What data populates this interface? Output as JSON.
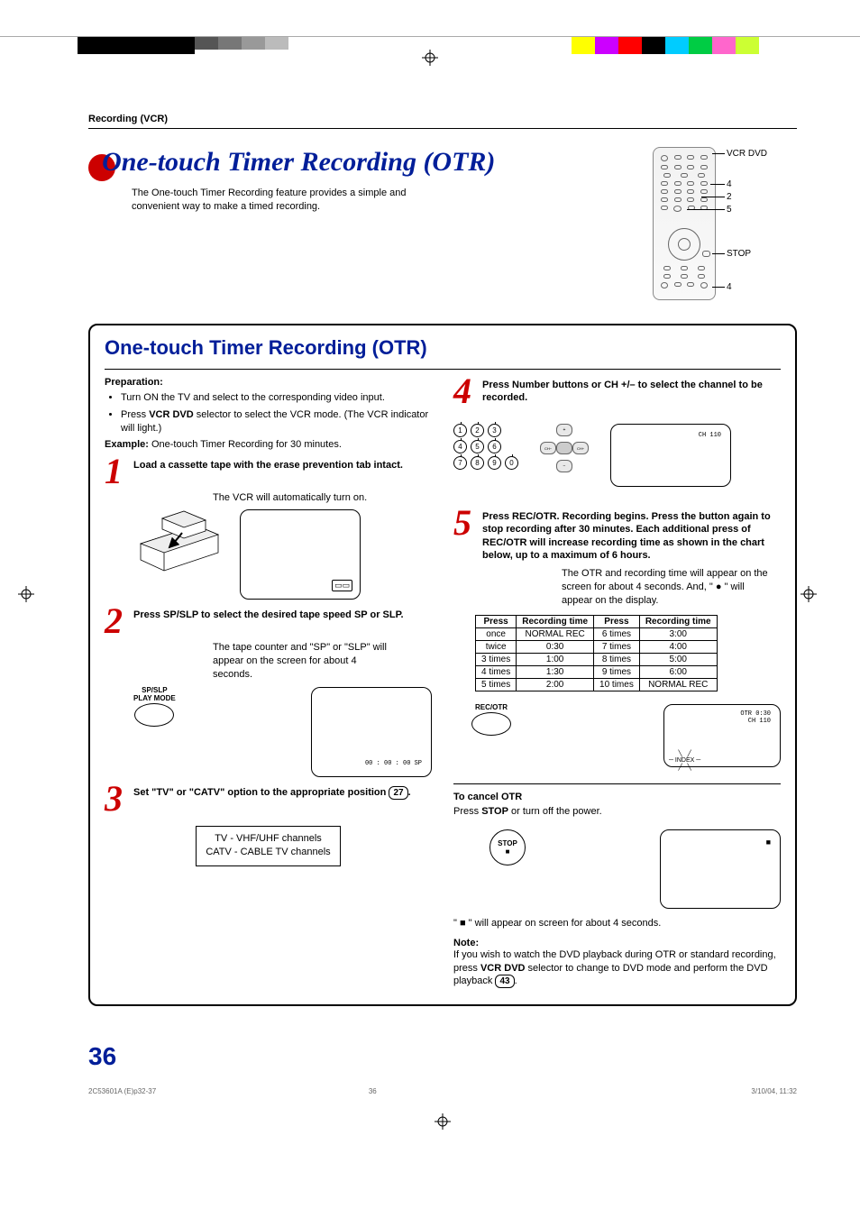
{
  "header": {
    "section": "Recording (VCR)",
    "title": "One-touch Timer Recording (OTR)",
    "intro": "The One-touch Timer Recording feature provides a simple and convenient way to make a timed recording."
  },
  "remote_labels": {
    "vcr_dvd": "VCR DVD",
    "k4": "4",
    "k2": "2",
    "k5": "5",
    "stop": "STOP",
    "k4b": "4"
  },
  "main_title": "One-touch Timer Recording (OTR)",
  "prep": {
    "heading": "Preparation:",
    "b1": "Turn ON the TV and select to the corresponding video input.",
    "b2a": "Press ",
    "b2b": "VCR DVD",
    "b2c": " selector to select the VCR mode. (The VCR indicator will light.)",
    "example_label": "Example:",
    "example_text": " One-touch Timer Recording for 30 minutes."
  },
  "steps": {
    "s1": {
      "title": "Load a cassette tape with the erase prevention tab intact.",
      "sub": "The VCR will automatically turn on."
    },
    "s2": {
      "title": "Press SP/SLP to select the desired tape speed SP or SLP.",
      "sub": "The tape counter and \"SP\" or \"SLP\" will appear on the screen for about 4 seconds.",
      "btn_label": "SP/SLP\nPLAY MODE",
      "screen_text": "00 : 00 : 00  SP"
    },
    "s3": {
      "title_a": "Set \"TV\" or \"CATV\" option to the appropriate position ",
      "title_page": "27",
      "title_b": ".",
      "box_line1": "TV      - VHF/UHF channels",
      "box_line2": "CATV - CABLE TV channels"
    },
    "s4": {
      "title": "Press Number buttons or CH +/– to select the channel to be recorded.",
      "screen_text": "CH 110"
    },
    "s5": {
      "title": "Press REC/OTR. Recording begins. Press the button again to stop recording after 30 minutes. Each additional press of REC/OTR will increase recording time as shown in the chart below, up to a maximum of 6 hours.",
      "sub": "The OTR and recording time will appear on the screen for about 4 seconds. And, \" ● \" will appear on the display.",
      "btn_label": "REC/OTR",
      "screen_text1": "OTR 0:30",
      "screen_text2": "CH 110",
      "index_label": "INDEX"
    }
  },
  "rec_table": {
    "h1": "Press",
    "h2": "Recording time",
    "h3": "Press",
    "h4": "Recording time",
    "rows": [
      [
        "once",
        "NORMAL REC",
        "6 times",
        "3:00"
      ],
      [
        "twice",
        "0:30",
        "7 times",
        "4:00"
      ],
      [
        "3 times",
        "1:00",
        "8 times",
        "5:00"
      ],
      [
        "4 times",
        "1:30",
        "9 times",
        "6:00"
      ],
      [
        "5 times",
        "2:00",
        "10 times",
        "NORMAL REC"
      ]
    ]
  },
  "cancel": {
    "heading": "To cancel OTR",
    "text_a": "Press ",
    "text_b": "STOP",
    "text_c": " or turn off the power.",
    "stop_btn": "STOP",
    "footer_a": "\" ",
    "footer_b": " \" will appear on screen for about 4 seconds."
  },
  "note": {
    "heading": "Note:",
    "text_a": "If you wish to watch the DVD playback during OTR or standard recording, press ",
    "text_b": "VCR DVD",
    "text_c": " selector to change to DVD mode and perform the DVD playback ",
    "page": "43",
    "text_d": "."
  },
  "footer": {
    "page_num": "36",
    "file_ref": "2C53601A (E)p32-37",
    "page_small": "36",
    "timestamp": "3/10/04, 11:32"
  }
}
